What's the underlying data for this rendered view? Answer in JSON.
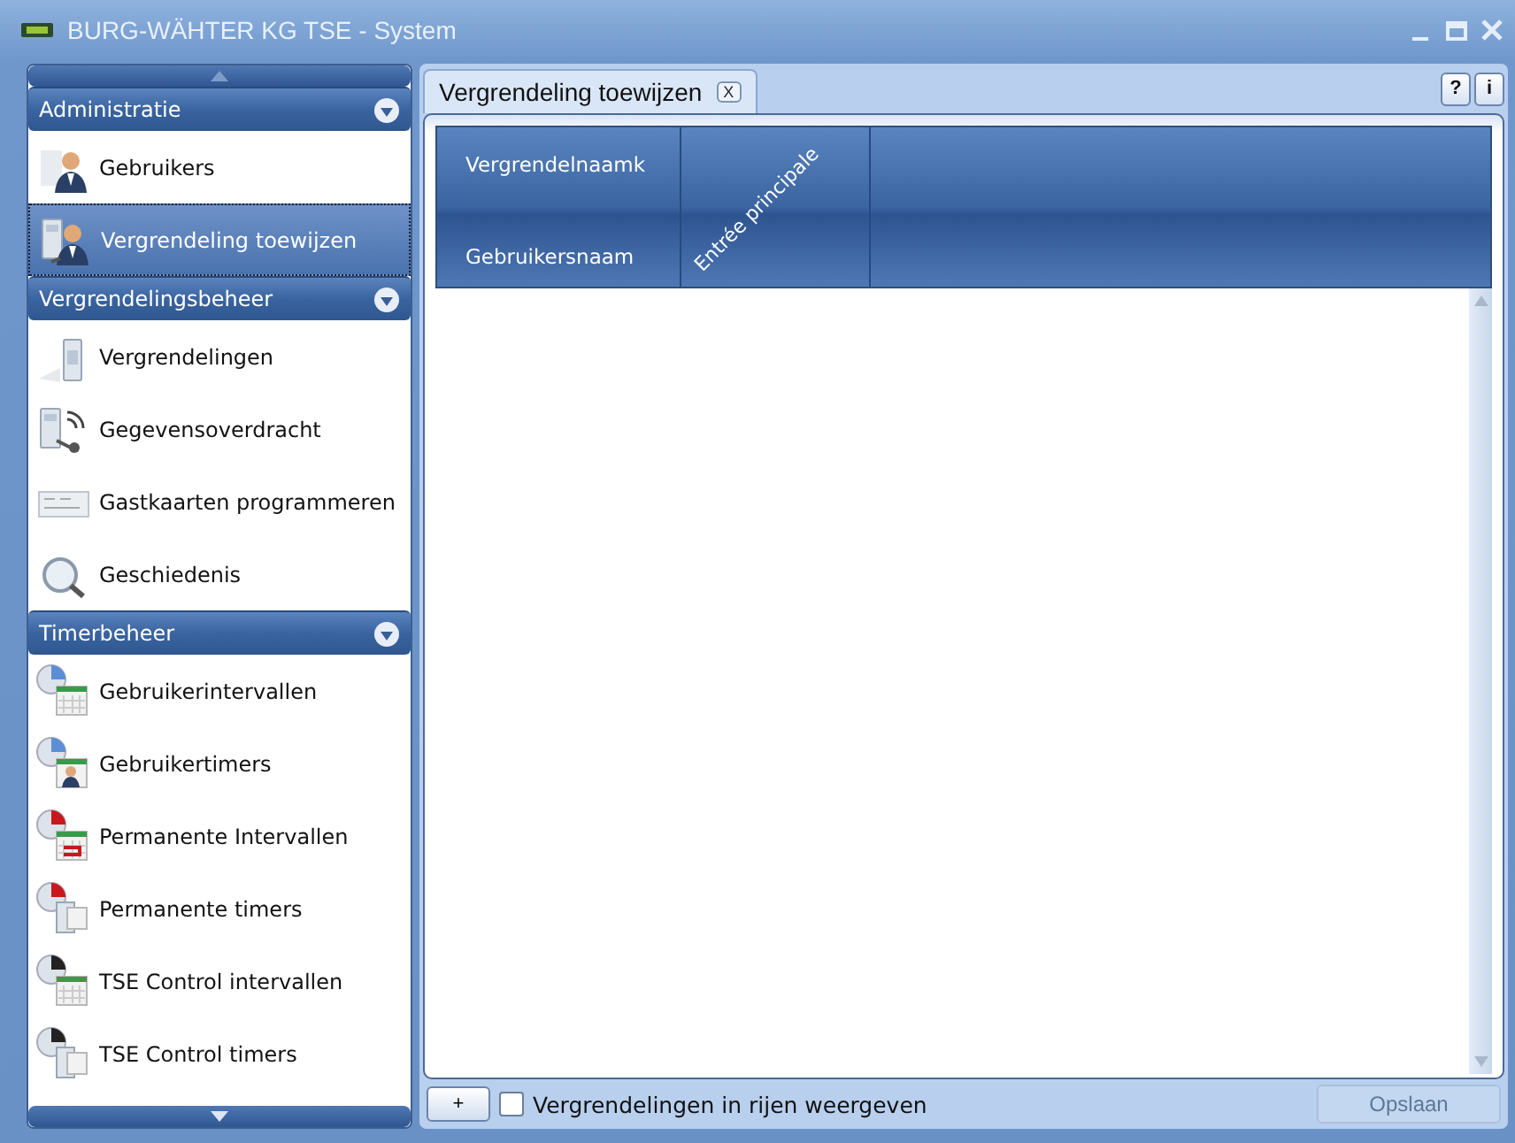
{
  "window": {
    "title": "BURG-WÄHTER KG TSE - System"
  },
  "sidebar": {
    "sections": [
      {
        "title": "Administratie",
        "expanded": true,
        "items": [
          {
            "label": "Gebruikers",
            "kind": "user",
            "selected": false
          },
          {
            "label": "Vergrendeling toewijzen",
            "kind": "assign",
            "selected": true
          }
        ]
      },
      {
        "title": "Vergrendelingsbeheer",
        "expanded": true,
        "items": [
          {
            "label": "Vergrendelingen",
            "kind": "lock",
            "selected": false
          },
          {
            "label": "Gegevensoverdracht",
            "kind": "transfer",
            "selected": false
          },
          {
            "label": "Gastkaarten programmeren",
            "kind": "card",
            "selected": false
          },
          {
            "label": "Geschiedenis",
            "kind": "history",
            "selected": false
          }
        ]
      },
      {
        "title": "Timerbeheer",
        "expanded": true,
        "items": [
          {
            "label": "Gebruikerintervallen",
            "kind": "interval",
            "color": "#5b8ed6",
            "selected": false
          },
          {
            "label": "Gebruikertimers",
            "kind": "usertimer",
            "color": "#5b8ed6",
            "selected": false
          },
          {
            "label": "Permanente Intervallen",
            "kind": "permanent",
            "color": "#c8181e",
            "selected": false
          },
          {
            "label": "Permanente timers",
            "kind": "lock-timer",
            "color": "#c8181e",
            "selected": false
          },
          {
            "label": "TSE Control intervallen",
            "kind": "interval",
            "color": "#222222",
            "selected": false
          },
          {
            "label": "TSE Control timers",
            "kind": "lock-timer",
            "color": "#222222",
            "selected": false
          }
        ]
      }
    ]
  },
  "tabs": [
    {
      "label": "Vergrendeling toewijzen",
      "close": "X",
      "selected": true
    }
  ],
  "help_buttons": [
    "?",
    "i"
  ],
  "grid": {
    "row_header_top": "Vergrendelnaamk",
    "row_header_bottom": "Gebruikersnaam",
    "columns": [
      "Entrée principale"
    ]
  },
  "footer": {
    "add": "+",
    "checkbox": {
      "label": "Vergrendelingen in rijen weergeven",
      "checked": false
    },
    "save": {
      "label": "Opslaan",
      "disabled": true
    }
  }
}
